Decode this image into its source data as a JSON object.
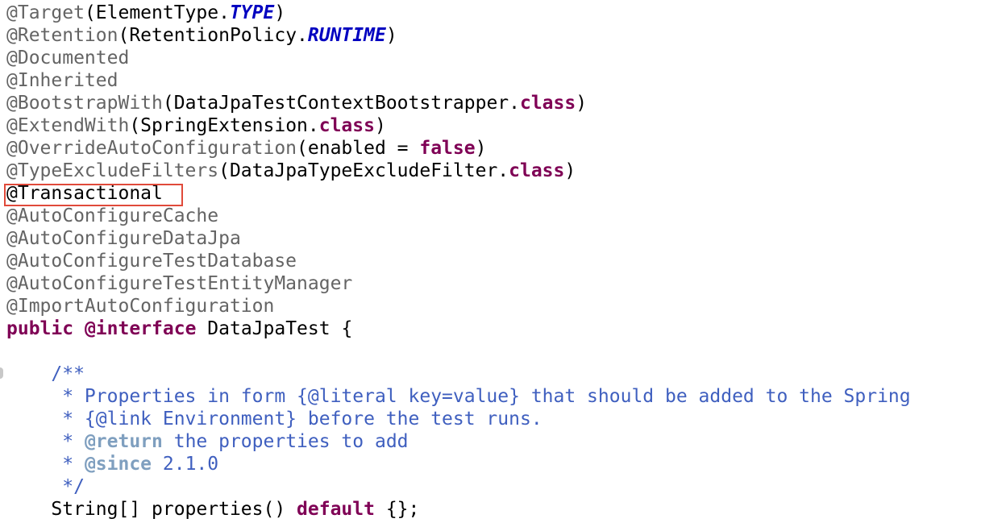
{
  "code": {
    "lines": [
      [
        {
          "t": "@Target",
          "c": "at"
        },
        {
          "t": "(ElementType.",
          "c": "plain"
        },
        {
          "t": "TYPE",
          "c": "const"
        },
        {
          "t": ")",
          "c": "plain"
        }
      ],
      [
        {
          "t": "@Retention",
          "c": "at"
        },
        {
          "t": "(RetentionPolicy.",
          "c": "plain"
        },
        {
          "t": "RUNTIME",
          "c": "const"
        },
        {
          "t": ")",
          "c": "plain"
        }
      ],
      [
        {
          "t": "@Documented",
          "c": "at"
        }
      ],
      [
        {
          "t": "@Inherited",
          "c": "at"
        }
      ],
      [
        {
          "t": "@BootstrapWith",
          "c": "at"
        },
        {
          "t": "(DataJpaTestContextBootstrapper.",
          "c": "plain"
        },
        {
          "t": "class",
          "c": "kw"
        },
        {
          "t": ")",
          "c": "plain"
        }
      ],
      [
        {
          "t": "@ExtendWith",
          "c": "at"
        },
        {
          "t": "(SpringExtension.",
          "c": "plain"
        },
        {
          "t": "class",
          "c": "kw"
        },
        {
          "t": ")",
          "c": "plain"
        }
      ],
      [
        {
          "t": "@OverrideAutoConfiguration",
          "c": "at"
        },
        {
          "t": "(enabled = ",
          "c": "plain"
        },
        {
          "t": "false",
          "c": "kw"
        },
        {
          "t": ")",
          "c": "plain"
        }
      ],
      [
        {
          "t": "@TypeExcludeFilters",
          "c": "at"
        },
        {
          "t": "(DataJpaTypeExcludeFilter.",
          "c": "plain"
        },
        {
          "t": "class",
          "c": "kw"
        },
        {
          "t": ")",
          "c": "plain"
        }
      ],
      [
        {
          "t": "@Transactional",
          "c": "plain"
        }
      ],
      [
        {
          "t": "@AutoConfigureCache",
          "c": "at"
        }
      ],
      [
        {
          "t": "@AutoConfigureDataJpa",
          "c": "at"
        }
      ],
      [
        {
          "t": "@AutoConfigureTestDatabase",
          "c": "at"
        }
      ],
      [
        {
          "t": "@AutoConfigureTestEntityManager",
          "c": "at"
        }
      ],
      [
        {
          "t": "@ImportAutoConfiguration",
          "c": "at"
        }
      ],
      [
        {
          "t": "public",
          "c": "kw"
        },
        {
          "t": " ",
          "c": "plain"
        },
        {
          "t": "@interface",
          "c": "kw"
        },
        {
          "t": " DataJpaTest {",
          "c": "plain"
        }
      ],
      [],
      [
        {
          "t": "    /**",
          "c": "doc"
        }
      ],
      [
        {
          "t": "     * Properties in form {@literal key=value} that should be added to the Spring",
          "c": "doc"
        }
      ],
      [
        {
          "t": "     * {@link Environment} before the test runs.",
          "c": "doc"
        }
      ],
      [
        {
          "t": "     * ",
          "c": "doc"
        },
        {
          "t": "@return",
          "c": "tag"
        },
        {
          "t": " the properties to add",
          "c": "doc"
        }
      ],
      [
        {
          "t": "     * ",
          "c": "doc"
        },
        {
          "t": "@since",
          "c": "tag"
        },
        {
          "t": " 2.1.0",
          "c": "doc"
        }
      ],
      [
        {
          "t": "     */",
          "c": "doc"
        }
      ],
      [
        {
          "t": "    String[] properties() ",
          "c": "plain"
        },
        {
          "t": "default",
          "c": "kw"
        },
        {
          "t": " {};",
          "c": "plain"
        }
      ]
    ]
  },
  "colors": {
    "annotation": "#646464",
    "keyword": "#7f0055",
    "constant": "#0000c0",
    "javadoc": "#3f5fbf",
    "javadoc_tag": "#7f9fbf",
    "highlight_box": "#e04a3a"
  }
}
